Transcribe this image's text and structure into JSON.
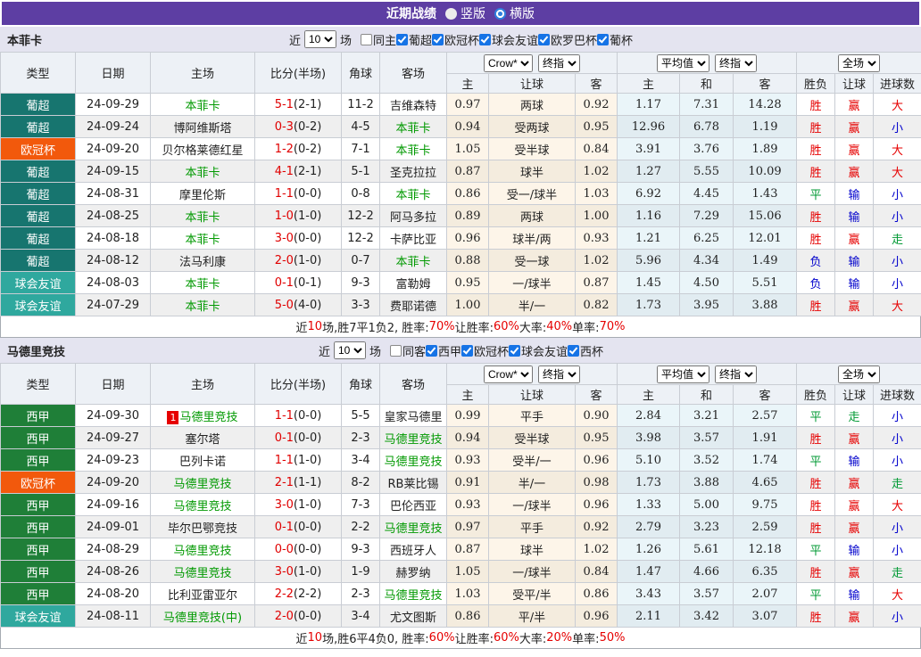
{
  "titlebar": {
    "title": "近期战绩",
    "radios": [
      {
        "label": "竖版",
        "selected": false
      },
      {
        "label": "横版",
        "selected": true
      }
    ]
  },
  "colors": {
    "titlebar_purple": "#5D3EA3",
    "filterbar_bg": "#E4E4F0",
    "header_bg": "#EDF1F6",
    "accent_red": "#E60000",
    "team_green": "#009900",
    "checkbox_blue": "#1673E6"
  },
  "league_colors": {
    "葡超": "#17756F",
    "欧冠杯": "#F2590C",
    "球会友谊": "#2FA89E",
    "西甲": "#1F7F38"
  },
  "result_colors": {
    "胜": "#E60000",
    "平": "#009933",
    "负": "#0000CC",
    "赢": "#E60000",
    "输": "#0000CC",
    "走": "#009933",
    "大": "#E60000",
    "小": "#0000CC"
  },
  "columns": {
    "main": [
      "类型",
      "日期",
      "主场",
      "比分(半场)",
      "角球",
      "客场"
    ],
    "sub": [
      "主",
      "让球",
      "客",
      "主",
      "和",
      "客",
      "胜负",
      "让球",
      "进球数"
    ],
    "selects": {
      "book": "Crow*",
      "book_alt": "终指",
      "avg": "平均值",
      "avg_alt": "终指",
      "scope": "全场"
    },
    "filter_labels": {
      "prefix": "近",
      "suffix": "场"
    }
  },
  "tables": [
    {
      "team": "本菲卡",
      "matches_count": "10",
      "same_label": "同主",
      "same_checked": false,
      "leagues": [
        {
          "label": "葡超",
          "checked": true
        },
        {
          "label": "欧冠杯",
          "checked": true
        },
        {
          "label": "球会友谊",
          "checked": true
        },
        {
          "label": "欧罗巴杯",
          "checked": true
        },
        {
          "label": "葡杯",
          "checked": true
        }
      ],
      "rows": [
        {
          "league": "葡超",
          "date": "24-09-29",
          "rank": "",
          "home": "本菲卡",
          "home_focus": true,
          "score": "5-1",
          "half": "(2-1)",
          "corner": "11-2",
          "away": "吉维森特",
          "away_focus": false,
          "book_home": "0.97",
          "handicap": "两球",
          "book_away": "0.92",
          "avg_home": "1.17",
          "avg_draw": "7.31",
          "avg_away": "14.28",
          "result": "胜",
          "handicap_result": "赢",
          "goals_result": "大"
        },
        {
          "league": "葡超",
          "date": "24-09-24",
          "rank": "",
          "home": "博阿维斯塔",
          "home_focus": false,
          "score": "0-3",
          "half": "(0-2)",
          "corner": "4-5",
          "away": "本菲卡",
          "away_focus": true,
          "book_home": "0.94",
          "handicap": "受两球",
          "book_away": "0.95",
          "avg_home": "12.96",
          "avg_draw": "6.78",
          "avg_away": "1.19",
          "result": "胜",
          "handicap_result": "赢",
          "goals_result": "小"
        },
        {
          "league": "欧冠杯",
          "date": "24-09-20",
          "rank": "",
          "home": "贝尔格莱德红星",
          "home_focus": false,
          "score": "1-2",
          "half": "(0-2)",
          "corner": "7-1",
          "away": "本菲卡",
          "away_focus": true,
          "book_home": "1.05",
          "handicap": "受半球",
          "book_away": "0.84",
          "avg_home": "3.91",
          "avg_draw": "3.76",
          "avg_away": "1.89",
          "result": "胜",
          "handicap_result": "赢",
          "goals_result": "大"
        },
        {
          "league": "葡超",
          "date": "24-09-15",
          "rank": "",
          "home": "本菲卡",
          "home_focus": true,
          "score": "4-1",
          "half": "(2-1)",
          "corner": "5-1",
          "away": "圣克拉拉",
          "away_focus": false,
          "book_home": "0.87",
          "handicap": "球半",
          "book_away": "1.02",
          "avg_home": "1.27",
          "avg_draw": "5.55",
          "avg_away": "10.09",
          "result": "胜",
          "handicap_result": "赢",
          "goals_result": "大"
        },
        {
          "league": "葡超",
          "date": "24-08-31",
          "rank": "",
          "home": "摩里伦斯",
          "home_focus": false,
          "score": "1-1",
          "half": "(0-0)",
          "corner": "0-8",
          "away": "本菲卡",
          "away_focus": true,
          "book_home": "0.86",
          "handicap": "受一/球半",
          "book_away": "1.03",
          "avg_home": "6.92",
          "avg_draw": "4.45",
          "avg_away": "1.43",
          "result": "平",
          "handicap_result": "输",
          "goals_result": "小"
        },
        {
          "league": "葡超",
          "date": "24-08-25",
          "rank": "",
          "home": "本菲卡",
          "home_focus": true,
          "score": "1-0",
          "half": "(1-0)",
          "corner": "12-2",
          "away": "阿马多拉",
          "away_focus": false,
          "book_home": "0.89",
          "handicap": "两球",
          "book_away": "1.00",
          "avg_home": "1.16",
          "avg_draw": "7.29",
          "avg_away": "15.06",
          "result": "胜",
          "handicap_result": "输",
          "goals_result": "小"
        },
        {
          "league": "葡超",
          "date": "24-08-18",
          "rank": "",
          "home": "本菲卡",
          "home_focus": true,
          "score": "3-0",
          "half": "(0-0)",
          "corner": "12-2",
          "away": "卡萨比亚",
          "away_focus": false,
          "book_home": "0.96",
          "handicap": "球半/两",
          "book_away": "0.93",
          "avg_home": "1.21",
          "avg_draw": "6.25",
          "avg_away": "12.01",
          "result": "胜",
          "handicap_result": "赢",
          "goals_result": "走"
        },
        {
          "league": "葡超",
          "date": "24-08-12",
          "rank": "",
          "home": "法马利康",
          "home_focus": false,
          "score": "2-0",
          "half": "(1-0)",
          "corner": "0-7",
          "away": "本菲卡",
          "away_focus": true,
          "book_home": "0.88",
          "handicap": "受一球",
          "book_away": "1.02",
          "avg_home": "5.96",
          "avg_draw": "4.34",
          "avg_away": "1.49",
          "result": "负",
          "handicap_result": "输",
          "goals_result": "小"
        },
        {
          "league": "球会友谊",
          "date": "24-08-03",
          "rank": "",
          "home": "本菲卡",
          "home_focus": true,
          "score": "0-1",
          "half": "(0-1)",
          "corner": "9-3",
          "away": "富勒姆",
          "away_focus": false,
          "book_home": "0.95",
          "handicap": "一/球半",
          "book_away": "0.87",
          "avg_home": "1.45",
          "avg_draw": "4.50",
          "avg_away": "5.51",
          "result": "负",
          "handicap_result": "输",
          "goals_result": "小"
        },
        {
          "league": "球会友谊",
          "date": "24-07-29",
          "rank": "",
          "home": "本菲卡",
          "home_focus": true,
          "score": "5-0",
          "half": "(4-0)",
          "corner": "3-3",
          "away": "费耶诺德",
          "away_focus": false,
          "book_home": "1.00",
          "handicap": "半/一",
          "book_away": "0.82",
          "avg_home": "1.73",
          "avg_draw": "3.95",
          "avg_away": "3.88",
          "result": "胜",
          "handicap_result": "赢",
          "goals_result": "大"
        }
      ],
      "summary": [
        {
          "text": "近"
        },
        {
          "text": "10",
          "red": true
        },
        {
          "text": "场,胜7平1负2, 胜率:"
        },
        {
          "text": "70%",
          "red": true
        },
        {
          "text": " 让胜率:"
        },
        {
          "text": "60%",
          "red": true
        },
        {
          "text": " 大率:"
        },
        {
          "text": "40%",
          "red": true
        },
        {
          "text": " 单率:"
        },
        {
          "text": "70%",
          "red": true
        }
      ]
    },
    {
      "team": "马德里竞技",
      "matches_count": "10",
      "same_label": "同客",
      "same_checked": false,
      "leagues": [
        {
          "label": "西甲",
          "checked": true
        },
        {
          "label": "欧冠杯",
          "checked": true
        },
        {
          "label": "球会友谊",
          "checked": true
        },
        {
          "label": "西杯",
          "checked": true
        }
      ],
      "rows": [
        {
          "league": "西甲",
          "date": "24-09-30",
          "rank": "1",
          "home": "马德里竞技",
          "home_focus": true,
          "score": "1-1",
          "half": "(0-0)",
          "corner": "5-5",
          "away": "皇家马德里",
          "away_focus": false,
          "book_home": "0.99",
          "handicap": "平手",
          "book_away": "0.90",
          "avg_home": "2.84",
          "avg_draw": "3.21",
          "avg_away": "2.57",
          "result": "平",
          "handicap_result": "走",
          "goals_result": "小"
        },
        {
          "league": "西甲",
          "date": "24-09-27",
          "rank": "",
          "home": "塞尔塔",
          "home_focus": false,
          "score": "0-1",
          "half": "(0-0)",
          "corner": "2-3",
          "away": "马德里竞技",
          "away_focus": true,
          "book_home": "0.94",
          "handicap": "受半球",
          "book_away": "0.95",
          "avg_home": "3.98",
          "avg_draw": "3.57",
          "avg_away": "1.91",
          "result": "胜",
          "handicap_result": "赢",
          "goals_result": "小"
        },
        {
          "league": "西甲",
          "date": "24-09-23",
          "rank": "",
          "home": "巴列卡诺",
          "home_focus": false,
          "score": "1-1",
          "half": "(1-0)",
          "corner": "3-4",
          "away": "马德里竞技",
          "away_focus": true,
          "book_home": "0.93",
          "handicap": "受半/一",
          "book_away": "0.96",
          "avg_home": "5.10",
          "avg_draw": "3.52",
          "avg_away": "1.74",
          "result": "平",
          "handicap_result": "输",
          "goals_result": "小"
        },
        {
          "league": "欧冠杯",
          "date": "24-09-20",
          "rank": "",
          "home": "马德里竞技",
          "home_focus": true,
          "score": "2-1",
          "half": "(1-1)",
          "corner": "8-2",
          "away": "RB莱比锡",
          "away_focus": false,
          "book_home": "0.91",
          "handicap": "半/一",
          "book_away": "0.98",
          "avg_home": "1.73",
          "avg_draw": "3.88",
          "avg_away": "4.65",
          "result": "胜",
          "handicap_result": "赢",
          "goals_result": "走"
        },
        {
          "league": "西甲",
          "date": "24-09-16",
          "rank": "",
          "home": "马德里竞技",
          "home_focus": true,
          "score": "3-0",
          "half": "(1-0)",
          "corner": "7-3",
          "away": "巴伦西亚",
          "away_focus": false,
          "book_home": "0.93",
          "handicap": "一/球半",
          "book_away": "0.96",
          "avg_home": "1.33",
          "avg_draw": "5.00",
          "avg_away": "9.75",
          "result": "胜",
          "handicap_result": "赢",
          "goals_result": "大"
        },
        {
          "league": "西甲",
          "date": "24-09-01",
          "rank": "",
          "home": "毕尔巴鄂竞技",
          "home_focus": false,
          "score": "0-1",
          "half": "(0-0)",
          "corner": "2-2",
          "away": "马德里竞技",
          "away_focus": true,
          "book_home": "0.97",
          "handicap": "平手",
          "book_away": "0.92",
          "avg_home": "2.79",
          "avg_draw": "3.23",
          "avg_away": "2.59",
          "result": "胜",
          "handicap_result": "赢",
          "goals_result": "小"
        },
        {
          "league": "西甲",
          "date": "24-08-29",
          "rank": "",
          "home": "马德里竞技",
          "home_focus": true,
          "score": "0-0",
          "half": "(0-0)",
          "corner": "9-3",
          "away": "西班牙人",
          "away_focus": false,
          "book_home": "0.87",
          "handicap": "球半",
          "book_away": "1.02",
          "avg_home": "1.26",
          "avg_draw": "5.61",
          "avg_away": "12.18",
          "result": "平",
          "handicap_result": "输",
          "goals_result": "小"
        },
        {
          "league": "西甲",
          "date": "24-08-26",
          "rank": "",
          "home": "马德里竞技",
          "home_focus": true,
          "score": "3-0",
          "half": "(1-0)",
          "corner": "1-9",
          "away": "赫罗纳",
          "away_focus": false,
          "book_home": "1.05",
          "handicap": "一/球半",
          "book_away": "0.84",
          "avg_home": "1.47",
          "avg_draw": "4.66",
          "avg_away": "6.35",
          "result": "胜",
          "handicap_result": "赢",
          "goals_result": "走"
        },
        {
          "league": "西甲",
          "date": "24-08-20",
          "rank": "",
          "home": "比利亚雷亚尔",
          "home_focus": false,
          "score": "2-2",
          "half": "(2-2)",
          "corner": "2-3",
          "away": "马德里竞技",
          "away_focus": true,
          "book_home": "1.03",
          "handicap": "受平/半",
          "book_away": "0.86",
          "avg_home": "3.43",
          "avg_draw": "3.57",
          "avg_away": "2.07",
          "result": "平",
          "handicap_result": "输",
          "goals_result": "大"
        },
        {
          "league": "球会友谊",
          "date": "24-08-11",
          "rank": "",
          "home": "马德里竞技(中)",
          "home_focus": true,
          "score": "2-0",
          "half": "(0-0)",
          "corner": "3-4",
          "away": "尤文图斯",
          "away_focus": false,
          "book_home": "0.86",
          "handicap": "平/半",
          "book_away": "0.96",
          "avg_home": "2.11",
          "avg_draw": "3.42",
          "avg_away": "3.07",
          "result": "胜",
          "handicap_result": "赢",
          "goals_result": "小"
        }
      ],
      "summary": [
        {
          "text": "近"
        },
        {
          "text": "10",
          "red": true
        },
        {
          "text": "场,胜6平4负0, 胜率:"
        },
        {
          "text": "60%",
          "red": true
        },
        {
          "text": " 让胜率:"
        },
        {
          "text": "60%",
          "red": true
        },
        {
          "text": " 大率:"
        },
        {
          "text": "20%",
          "red": true
        },
        {
          "text": " 单率:"
        },
        {
          "text": "50%",
          "red": true
        }
      ]
    }
  ]
}
